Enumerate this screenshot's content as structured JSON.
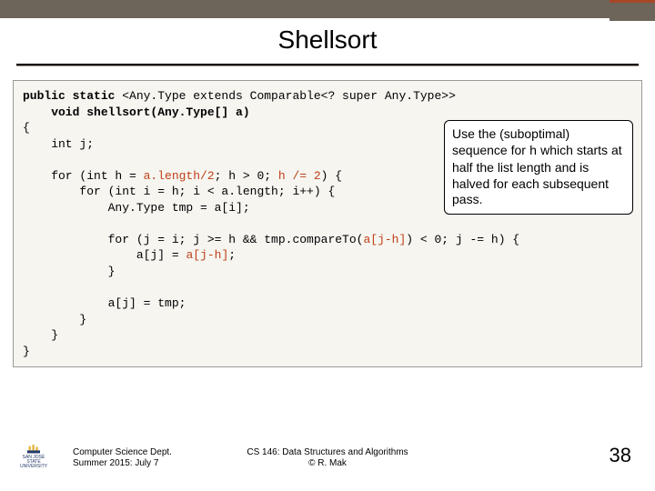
{
  "title": "Shellsort",
  "code": {
    "line1a": "public static ",
    "line1b": "<Any.Type extends Comparable<? super Any.Type>>",
    "line2": "    void shellsort(Any.Type[] a)",
    "line3": "{",
    "line4": "    int j;",
    "line5": "",
    "line6a": "    for (int h = ",
    "line6b": "a.length/2",
    "line6c": "; h > 0; ",
    "line6d": "h /= 2",
    "line6e": ") {",
    "line7": "        for (int i = h; i < a.length; i++) {",
    "line8": "            Any.Type tmp = a[i];",
    "line9": "",
    "line10a": "            for (j = i; j >= h && tmp.compareTo(",
    "line10b": "a[j-h]",
    "line10c": ") < 0; j -= h) {",
    "line11a": "                a[j] = ",
    "line11b": "a[j-h]",
    "line11c": ";",
    "line12": "            }",
    "line13": "",
    "line14": "            a[j] = tmp;",
    "line15": "        }",
    "line16": "    }",
    "line17": "}"
  },
  "callout": {
    "pre": "Use the (suboptimal) sequence for ",
    "var": "h",
    "post": " which starts at half the list length and is halved for each subsequent pass."
  },
  "footer": {
    "left1": "Computer Science Dept.",
    "left2": "Summer 2015: July 7",
    "center1": "CS 146: Data Structures and Algorithms",
    "center2": "© R. Mak",
    "page": "38",
    "logo_text": "SAN JOSÉ STATE UNIVERSITY"
  }
}
